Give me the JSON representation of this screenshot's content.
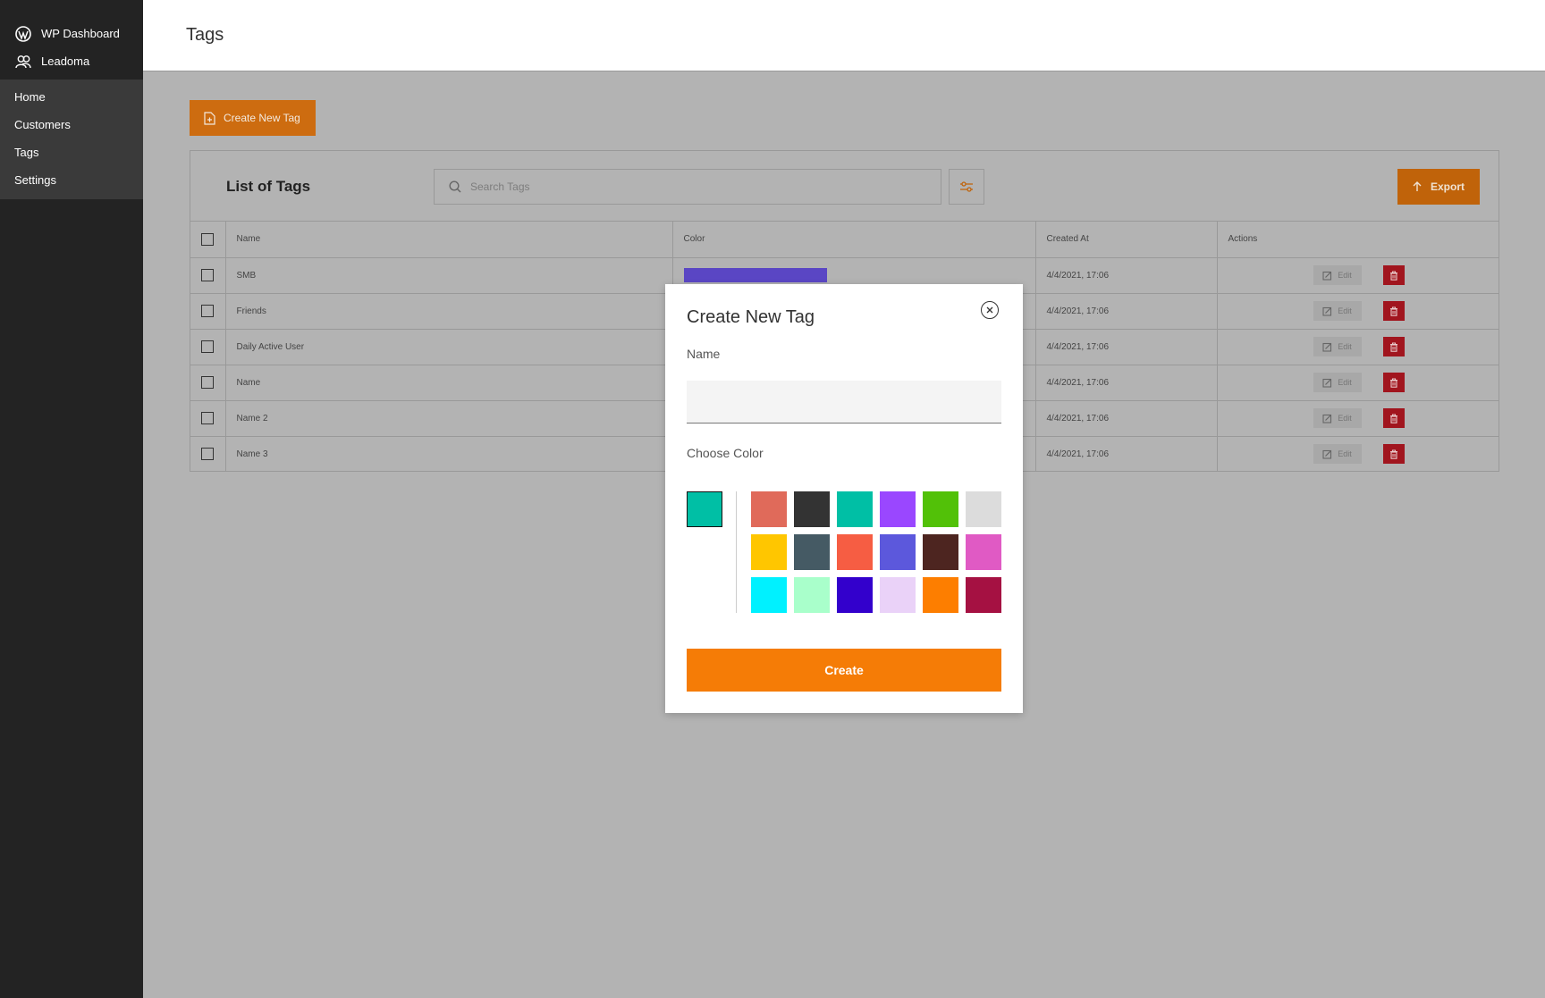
{
  "sidebar": {
    "brand": [
      {
        "label": "WP Dashboard",
        "icon": "wordpress-icon"
      },
      {
        "label": "Leadoma",
        "icon": "users-icon"
      }
    ],
    "items": [
      {
        "label": "Home"
      },
      {
        "label": "Customers"
      },
      {
        "label": "Tags"
      },
      {
        "label": "Settings"
      }
    ]
  },
  "header": {
    "title": "Tags"
  },
  "toolbar": {
    "create_label": "Create New Tag"
  },
  "list": {
    "title": "List of Tags",
    "search_placeholder": "Search Tags",
    "export_label": "Export"
  },
  "table": {
    "columns": {
      "name": "Name",
      "color": "Color",
      "created_at": "Created At",
      "actions": "Actions"
    },
    "edit_label": "Edit",
    "rows": [
      {
        "name": "SMB",
        "color": "#5a46c4",
        "created_at": "4/4/2021, 17:06"
      },
      {
        "name": "Friends",
        "color": "",
        "created_at": "4/4/2021, 17:06"
      },
      {
        "name": "Daily Active User",
        "color": "",
        "created_at": "4/4/2021, 17:06"
      },
      {
        "name": "Name",
        "color": "",
        "created_at": "4/4/2021, 17:06"
      },
      {
        "name": "Name 2",
        "color": "",
        "created_at": "4/4/2021, 17:06"
      },
      {
        "name": "Name 3",
        "color": "",
        "created_at": "4/4/2021, 17:06"
      }
    ]
  },
  "modal": {
    "title": "Create New Tag",
    "name_label": "Name",
    "name_value": "",
    "color_label": "Choose Color",
    "selected_color": "#00bfa5",
    "swatches": [
      "#e06a5a",
      "#333333",
      "#00bfa5",
      "#9a47ff",
      "#52c108",
      "#dcdcdc",
      "#ffc600",
      "#455a64",
      "#f65d43",
      "#5c58dc",
      "#4d2520",
      "#e05ac4",
      "#00f1ff",
      "#a9ffcb",
      "#3300cc",
      "#ead2f8",
      "#fd7e00",
      "#a51142"
    ],
    "create_label": "Create"
  }
}
